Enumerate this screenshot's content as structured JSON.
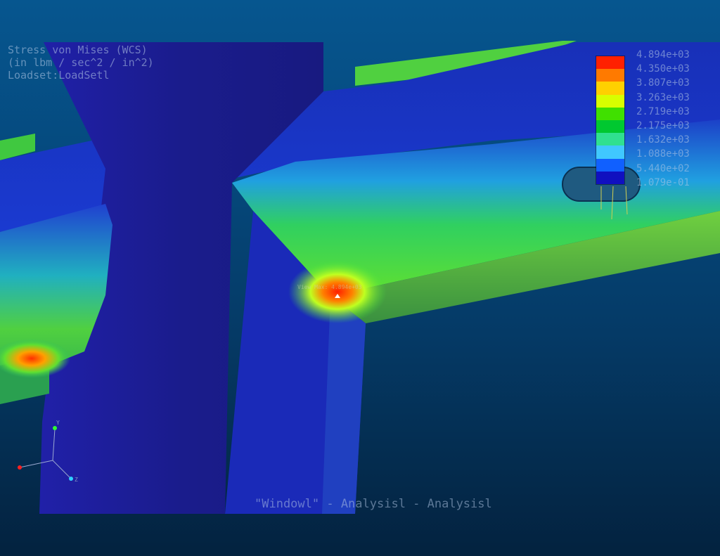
{
  "window": {
    "label": "\"Windowl\" - Analysisl - Analysisl"
  },
  "result_info": {
    "line1": "Stress von Mises (WCS)",
    "line2": "(in lbm / sec^2 / in^2)",
    "line3": "Loadset:LoadSetl"
  },
  "legend": {
    "labels": [
      "4.894e+03",
      "4.350e+03",
      "3.807e+03",
      "3.263e+03",
      "2.719e+03",
      "2.175e+03",
      "1.632e+03",
      "1.088e+03",
      "5.440e+02",
      "1.079e-01"
    ],
    "colors": [
      "#ff2000",
      "#ff7a00",
      "#ffd000",
      "#d8ff00",
      "#40e000",
      "#00c830",
      "#30e090",
      "#40c8ff",
      "#1060ff",
      "#1010c0"
    ]
  },
  "probe": {
    "label": "View Max: 4.894e+03"
  },
  "triad": {
    "y_axis": "Y",
    "z_axis": "Z",
    "x_color": "#ff2020",
    "y_color": "#30ff30",
    "z_color": "#30d0ff"
  },
  "colors": {
    "background_top": "#06568f",
    "background_bottom": "#03223f",
    "part_dark": "#1a1f8a",
    "stress_max": "#ff2000"
  }
}
